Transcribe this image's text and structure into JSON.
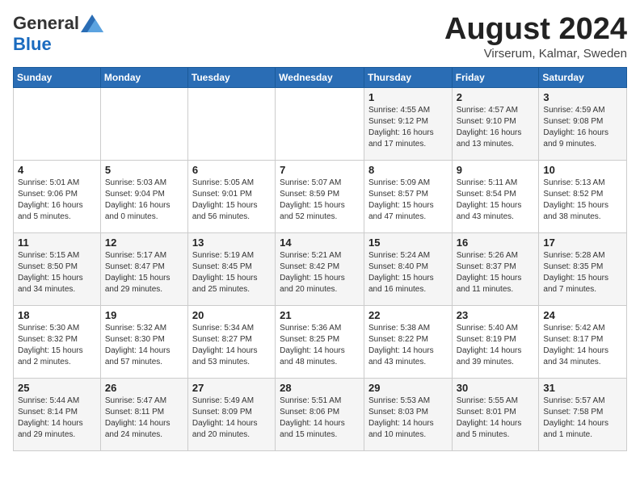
{
  "header": {
    "logo_general": "General",
    "logo_blue": "Blue",
    "month_title": "August 2024",
    "location": "Virserum, Kalmar, Sweden"
  },
  "days_of_week": [
    "Sunday",
    "Monday",
    "Tuesday",
    "Wednesday",
    "Thursday",
    "Friday",
    "Saturday"
  ],
  "weeks": [
    [
      {
        "day": "",
        "info": ""
      },
      {
        "day": "",
        "info": ""
      },
      {
        "day": "",
        "info": ""
      },
      {
        "day": "",
        "info": ""
      },
      {
        "day": "1",
        "info": "Sunrise: 4:55 AM\nSunset: 9:12 PM\nDaylight: 16 hours\nand 17 minutes."
      },
      {
        "day": "2",
        "info": "Sunrise: 4:57 AM\nSunset: 9:10 PM\nDaylight: 16 hours\nand 13 minutes."
      },
      {
        "day": "3",
        "info": "Sunrise: 4:59 AM\nSunset: 9:08 PM\nDaylight: 16 hours\nand 9 minutes."
      }
    ],
    [
      {
        "day": "4",
        "info": "Sunrise: 5:01 AM\nSunset: 9:06 PM\nDaylight: 16 hours\nand 5 minutes."
      },
      {
        "day": "5",
        "info": "Sunrise: 5:03 AM\nSunset: 9:04 PM\nDaylight: 16 hours\nand 0 minutes."
      },
      {
        "day": "6",
        "info": "Sunrise: 5:05 AM\nSunset: 9:01 PM\nDaylight: 15 hours\nand 56 minutes."
      },
      {
        "day": "7",
        "info": "Sunrise: 5:07 AM\nSunset: 8:59 PM\nDaylight: 15 hours\nand 52 minutes."
      },
      {
        "day": "8",
        "info": "Sunrise: 5:09 AM\nSunset: 8:57 PM\nDaylight: 15 hours\nand 47 minutes."
      },
      {
        "day": "9",
        "info": "Sunrise: 5:11 AM\nSunset: 8:54 PM\nDaylight: 15 hours\nand 43 minutes."
      },
      {
        "day": "10",
        "info": "Sunrise: 5:13 AM\nSunset: 8:52 PM\nDaylight: 15 hours\nand 38 minutes."
      }
    ],
    [
      {
        "day": "11",
        "info": "Sunrise: 5:15 AM\nSunset: 8:50 PM\nDaylight: 15 hours\nand 34 minutes."
      },
      {
        "day": "12",
        "info": "Sunrise: 5:17 AM\nSunset: 8:47 PM\nDaylight: 15 hours\nand 29 minutes."
      },
      {
        "day": "13",
        "info": "Sunrise: 5:19 AM\nSunset: 8:45 PM\nDaylight: 15 hours\nand 25 minutes."
      },
      {
        "day": "14",
        "info": "Sunrise: 5:21 AM\nSunset: 8:42 PM\nDaylight: 15 hours\nand 20 minutes."
      },
      {
        "day": "15",
        "info": "Sunrise: 5:24 AM\nSunset: 8:40 PM\nDaylight: 15 hours\nand 16 minutes."
      },
      {
        "day": "16",
        "info": "Sunrise: 5:26 AM\nSunset: 8:37 PM\nDaylight: 15 hours\nand 11 minutes."
      },
      {
        "day": "17",
        "info": "Sunrise: 5:28 AM\nSunset: 8:35 PM\nDaylight: 15 hours\nand 7 minutes."
      }
    ],
    [
      {
        "day": "18",
        "info": "Sunrise: 5:30 AM\nSunset: 8:32 PM\nDaylight: 15 hours\nand 2 minutes."
      },
      {
        "day": "19",
        "info": "Sunrise: 5:32 AM\nSunset: 8:30 PM\nDaylight: 14 hours\nand 57 minutes."
      },
      {
        "day": "20",
        "info": "Sunrise: 5:34 AM\nSunset: 8:27 PM\nDaylight: 14 hours\nand 53 minutes."
      },
      {
        "day": "21",
        "info": "Sunrise: 5:36 AM\nSunset: 8:25 PM\nDaylight: 14 hours\nand 48 minutes."
      },
      {
        "day": "22",
        "info": "Sunrise: 5:38 AM\nSunset: 8:22 PM\nDaylight: 14 hours\nand 43 minutes."
      },
      {
        "day": "23",
        "info": "Sunrise: 5:40 AM\nSunset: 8:19 PM\nDaylight: 14 hours\nand 39 minutes."
      },
      {
        "day": "24",
        "info": "Sunrise: 5:42 AM\nSunset: 8:17 PM\nDaylight: 14 hours\nand 34 minutes."
      }
    ],
    [
      {
        "day": "25",
        "info": "Sunrise: 5:44 AM\nSunset: 8:14 PM\nDaylight: 14 hours\nand 29 minutes."
      },
      {
        "day": "26",
        "info": "Sunrise: 5:47 AM\nSunset: 8:11 PM\nDaylight: 14 hours\nand 24 minutes."
      },
      {
        "day": "27",
        "info": "Sunrise: 5:49 AM\nSunset: 8:09 PM\nDaylight: 14 hours\nand 20 minutes."
      },
      {
        "day": "28",
        "info": "Sunrise: 5:51 AM\nSunset: 8:06 PM\nDaylight: 14 hours\nand 15 minutes."
      },
      {
        "day": "29",
        "info": "Sunrise: 5:53 AM\nSunset: 8:03 PM\nDaylight: 14 hours\nand 10 minutes."
      },
      {
        "day": "30",
        "info": "Sunrise: 5:55 AM\nSunset: 8:01 PM\nDaylight: 14 hours\nand 5 minutes."
      },
      {
        "day": "31",
        "info": "Sunrise: 5:57 AM\nSunset: 7:58 PM\nDaylight: 14 hours\nand 1 minute."
      }
    ]
  ]
}
